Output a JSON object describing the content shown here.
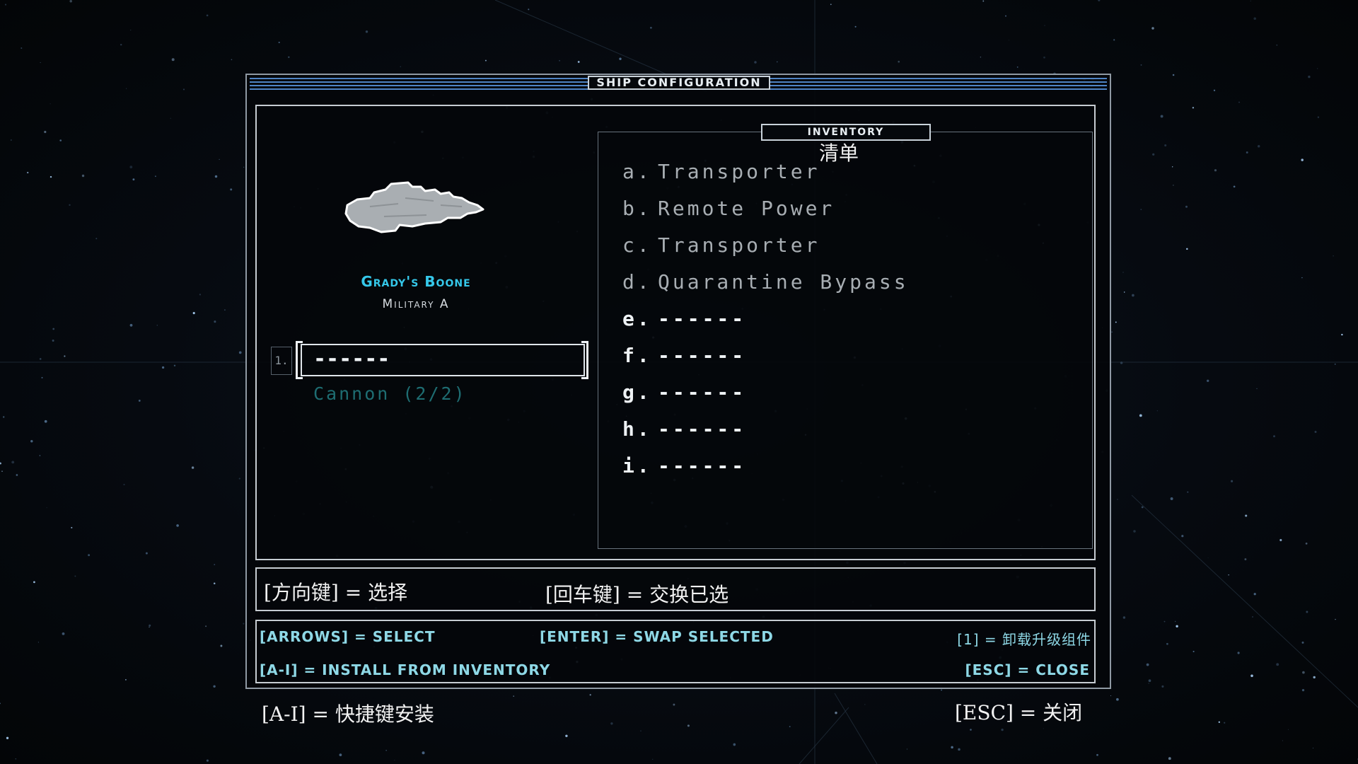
{
  "window": {
    "title": "SHIP CONFIGURATION"
  },
  "ship": {
    "name": "Grady's Boone",
    "class": "Military A",
    "slot": {
      "number": "1.",
      "value": "------",
      "caption": "Cannon (2/2)"
    }
  },
  "inventory": {
    "title": "INVENTORY",
    "subtitle": "清单",
    "items": [
      {
        "key": "a.",
        "label": "Transporter"
      },
      {
        "key": "b.",
        "label": "Remote Power"
      },
      {
        "key": "c.",
        "label": "Transporter"
      },
      {
        "key": "d.",
        "label": "Quarantine Bypass"
      },
      {
        "key": "e.",
        "label": "------"
      },
      {
        "key": "f.",
        "label": "------"
      },
      {
        "key": "g.",
        "label": "------"
      },
      {
        "key": "h.",
        "label": "------"
      },
      {
        "key": "i.",
        "label": "------"
      }
    ]
  },
  "hints_cn": {
    "select": "[方向键] = 选择",
    "swap": "[回车键] = 交换已选",
    "install": "[A-I] = 快捷键安装",
    "close": "[ESC] = 关闭"
  },
  "controls": {
    "arrows": "[ARROWS] = SELECT",
    "enter": "[ENTER] = SWAP SELECTED",
    "uninstall": "[1] = 卸载升级组件",
    "install": "[A-I] = INSTALL FROM INVENTORY",
    "close": "[ESC] = CLOSE"
  },
  "colors": {
    "ship_name": "#35c8ea",
    "controls_text": "#8ed8e6",
    "slot_caption": "#1e6d72",
    "title_line": "#4f84c4"
  }
}
